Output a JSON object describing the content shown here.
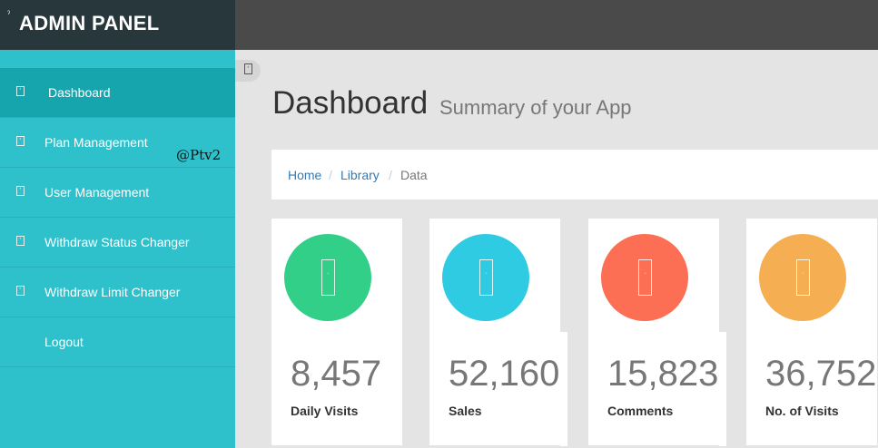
{
  "brand": {
    "mark": "ˀ",
    "title": "ADMIN PANEL"
  },
  "sidebar": {
    "items": [
      {
        "label": "Dashboard",
        "icon": "dashboard-icon",
        "active": true
      },
      {
        "label": "Plan Management",
        "icon": "plan-icon"
      },
      {
        "label": "User Management",
        "icon": "users-icon"
      },
      {
        "label": "Withdraw Status Changer",
        "icon": "status-icon"
      },
      {
        "label": "Withdraw Limit Changer",
        "icon": "limit-icon"
      },
      {
        "label": "Logout"
      }
    ]
  },
  "watermark": "@Ptv2",
  "page": {
    "title": "Dashboard",
    "subtitle": "Summary of your App"
  },
  "breadcrumb": {
    "home": "Home",
    "library": "Library",
    "separator": "/",
    "current": "Data"
  },
  "stats": [
    {
      "value": "8,457",
      "label": "Daily Visits",
      "color": "#32cf88",
      "icon": "visits-icon"
    },
    {
      "value": "52,160",
      "label": "Sales",
      "color": "#2ecbe3",
      "icon": "sales-icon"
    },
    {
      "value": "15,823",
      "label": "Comments",
      "color": "#fd6f54",
      "icon": "comments-icon"
    },
    {
      "value": "36,752",
      "label": "No. of Visits",
      "color": "#f5ae51",
      "icon": "total-visits-icon"
    }
  ]
}
